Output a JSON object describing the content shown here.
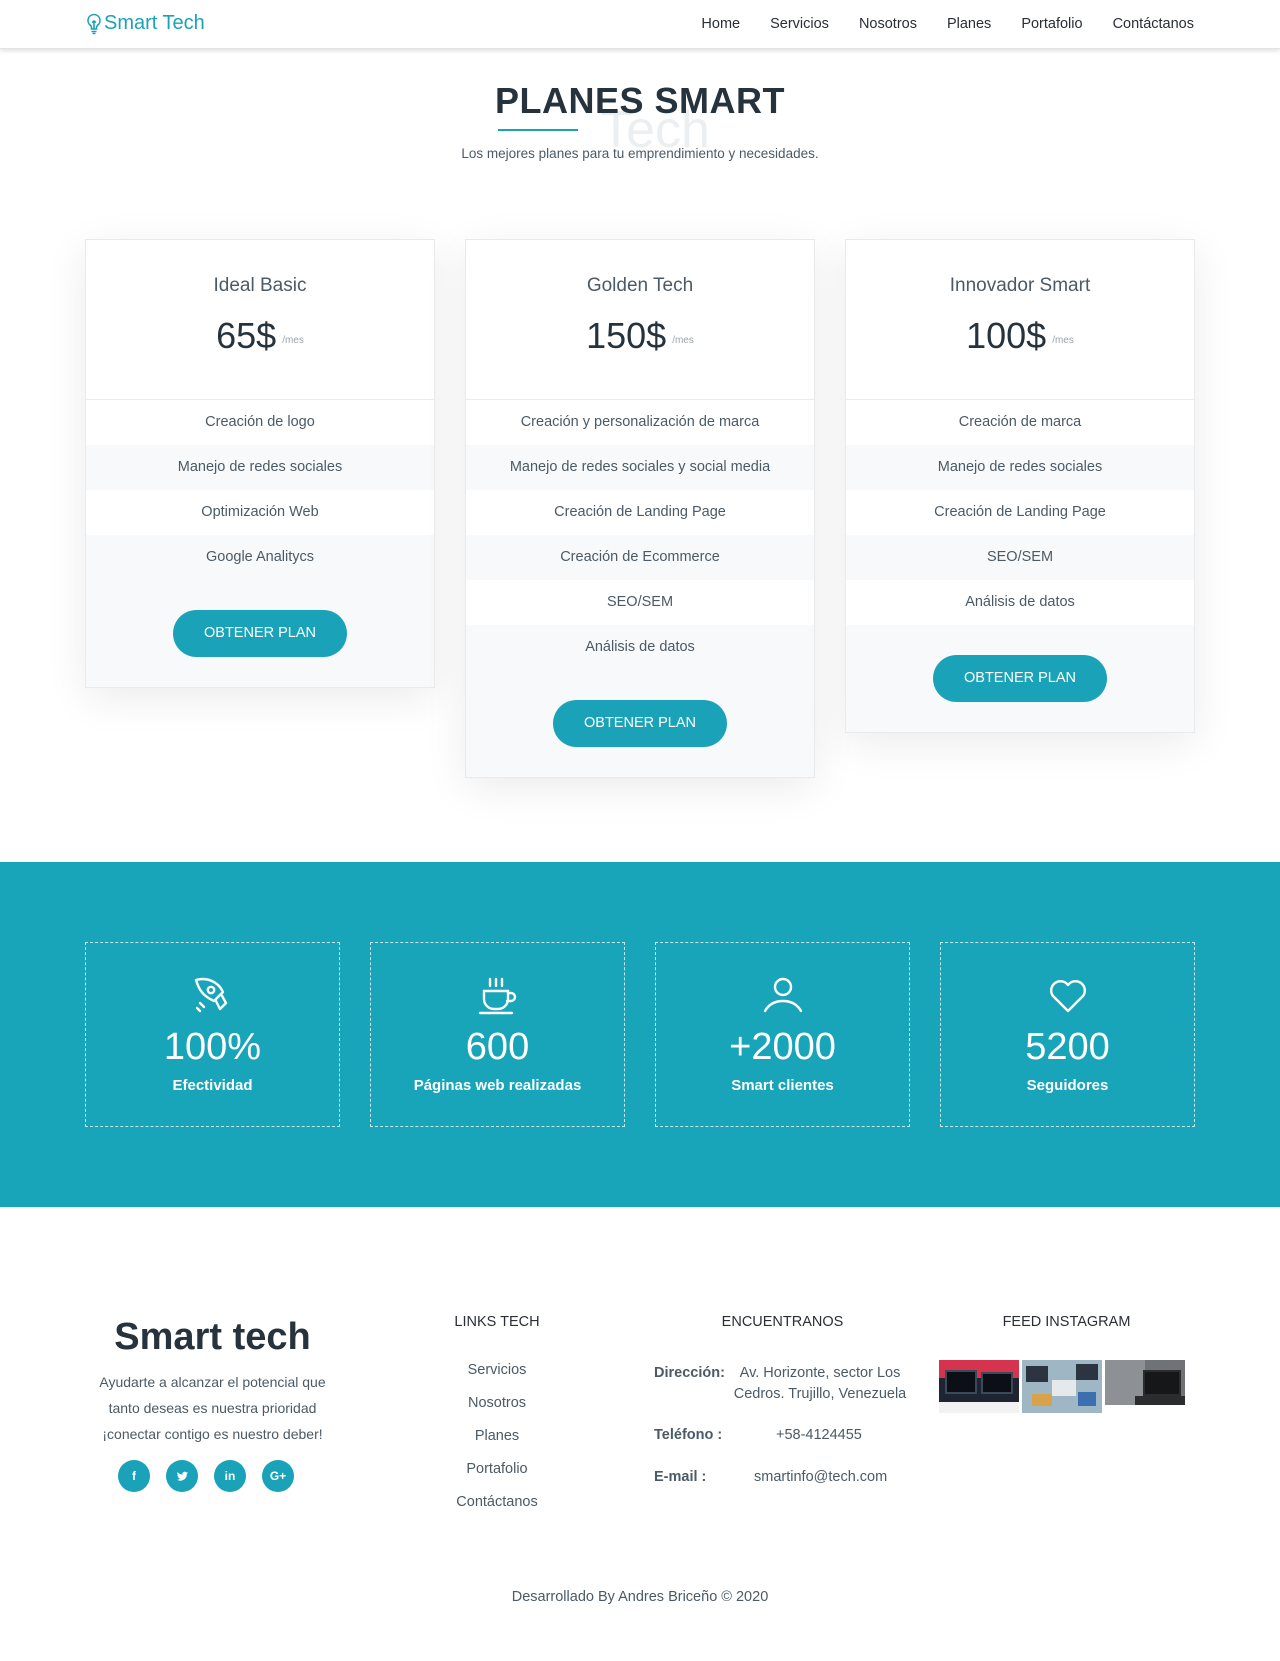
{
  "nav": {
    "brand": "Smart Tech",
    "links": [
      "Home",
      "Servicios",
      "Nosotros",
      "Planes",
      "Portafolio",
      "Contáctanos"
    ]
  },
  "section": {
    "title": "PLANES SMART",
    "ghost": "Tech",
    "subtitle": "Los mejores planes para tu emprendimiento y necesidades."
  },
  "plans": [
    {
      "name": "Ideal Basic",
      "price": "65$",
      "period": "/mes",
      "features": [
        "Creación de logo",
        "Manejo de redes sociales",
        "Optimización Web",
        "Google Analitycs"
      ],
      "button": "OBTENER PLAN"
    },
    {
      "name": "Golden Tech",
      "price": "150$",
      "period": "/mes",
      "features": [
        "Creación y personalización de marca",
        "Manejo de redes sociales y social media",
        "Creación de Landing Page",
        "Creación de Ecommerce",
        "SEO/SEM",
        "Análisis de datos"
      ],
      "button": "OBTENER PLAN"
    },
    {
      "name": "Innovador Smart",
      "price": "100$",
      "period": "/mes",
      "features": [
        "Creación de marca",
        "Manejo de redes sociales",
        "Creación de Landing Page",
        "SEO/SEM",
        "Análisis de datos"
      ],
      "button": "OBTENER PLAN"
    }
  ],
  "stats": [
    {
      "icon": "rocket-icon",
      "value": "100%",
      "label": "Efectividad"
    },
    {
      "icon": "coffee-cup-icon",
      "value": "600",
      "label": "Páginas web realizadas"
    },
    {
      "icon": "user-icon",
      "value": "+2000",
      "label": "Smart clientes"
    },
    {
      "icon": "heart-icon",
      "value": "5200",
      "label": "Seguidores"
    }
  ],
  "footer": {
    "brand": "Smart tech",
    "tagline": "Ayudarte a alcanzar el potencial que tanto deseas es nuestra prioridad ¡conectar contigo es nuestro deber!",
    "social": [
      {
        "icon": "facebook-icon",
        "glyph": "f"
      },
      {
        "icon": "twitter-icon",
        "glyph": "t"
      },
      {
        "icon": "linkedin-icon",
        "glyph": "in"
      },
      {
        "icon": "google-plus-icon",
        "glyph": "G+"
      }
    ],
    "links_title": "LINKS TECH",
    "links": [
      "Servicios",
      "Nosotros",
      "Planes",
      "Portafolio",
      "Contáctanos"
    ],
    "contact_title": "ENCUENTRANOS",
    "address_label": "Dirección:",
    "address": "Av. Horizonte, sector Los Cedros. Trujillo, Venezuela",
    "phone_label": "Teléfono :",
    "phone": "+58-4124455",
    "email_label": "E-mail :",
    "email": "smartinfo@tech.com",
    "instagram_title": "FEED INSTAGRAM",
    "copyright": "Desarrollado By Andres Briceño © 2020"
  },
  "colors": {
    "accent": "#1aa3b8",
    "dark": "#26333d",
    "text": "#4b5a66"
  }
}
